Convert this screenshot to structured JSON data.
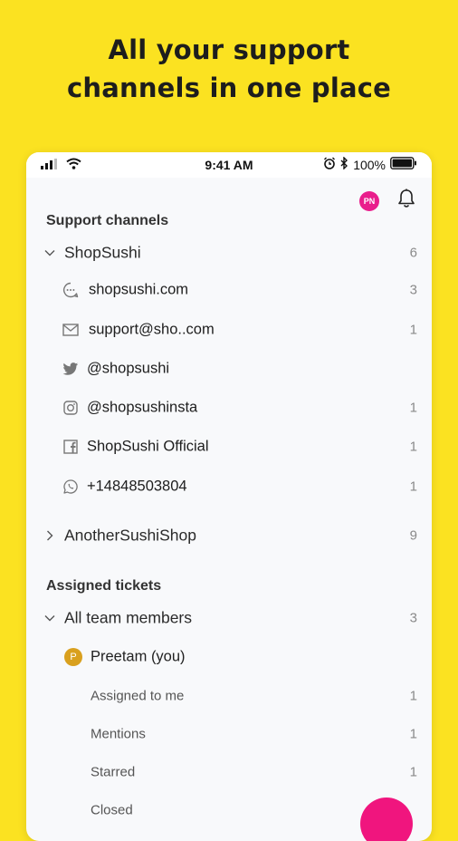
{
  "headline": {
    "line1": "All your support",
    "line2": "channels in one place"
  },
  "status_bar": {
    "time": "9:41 AM",
    "battery": "100%"
  },
  "header": {
    "avatar_initials": "PN"
  },
  "support_channels": {
    "title": "Support channels",
    "groups": [
      {
        "name": "ShopSushi",
        "count": "6",
        "expanded": true,
        "channels": [
          {
            "icon": "chat-icon",
            "label": "shopsushi.com",
            "count": "3"
          },
          {
            "icon": "mail-icon",
            "label": "support@sho..com",
            "count": "1"
          },
          {
            "icon": "twitter-icon",
            "label": "@shopsushi",
            "count": ""
          },
          {
            "icon": "instagram-icon",
            "label": "@shopsushinsta",
            "count": "1"
          },
          {
            "icon": "facebook-icon",
            "label": "ShopSushi Official",
            "count": "1"
          },
          {
            "icon": "whatsapp-icon",
            "label": "+14848503804",
            "count": "1"
          }
        ]
      },
      {
        "name": "AnotherSushiShop",
        "count": "9",
        "expanded": false
      }
    ]
  },
  "assigned_tickets": {
    "title": "Assigned tickets",
    "group": {
      "name": "All team members",
      "count": "3"
    },
    "member": {
      "initial": "P",
      "name": "Preetam (you)"
    },
    "items": [
      {
        "label": "Assigned to me",
        "count": "1"
      },
      {
        "label": "Mentions",
        "count": "1"
      },
      {
        "label": "Starred",
        "count": "1"
      },
      {
        "label": "Closed",
        "count": ""
      }
    ]
  },
  "colors": {
    "background": "#FBE221",
    "accent": "#F0157E",
    "avatar_pn": "#E91E8C",
    "avatar_p": "#D9A01E"
  }
}
